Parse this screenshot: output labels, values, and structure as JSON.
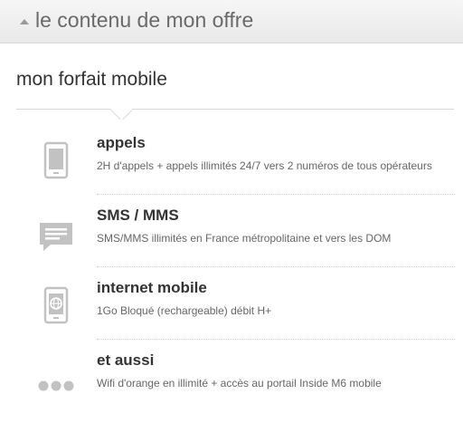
{
  "header": {
    "title": "le contenu de mon offre",
    "toggle_icon": "triangle-up-icon"
  },
  "section": {
    "title": "mon forfait mobile"
  },
  "items": [
    {
      "icon": "phone-icon",
      "label": "appels",
      "desc": "2H d'appels + appels illimités 24/7 vers 2 numéros de tous opérateurs"
    },
    {
      "icon": "message-icon",
      "label": "SMS / MMS",
      "desc": "SMS/MMS illimités en France métropolitaine et vers les DOM"
    },
    {
      "icon": "mobile-internet-icon",
      "label": "internet mobile",
      "desc": "1Go Bloqué (rechargeable) débit H+"
    },
    {
      "icon": "more-dots-icon",
      "label": "et aussi",
      "desc": "Wifi d'orange en illimité + accès au portail Inside M6 mobile"
    }
  ],
  "colors": {
    "icon_gray": "#c2c2c2",
    "text_dark": "#333333",
    "text_light": "#666666"
  }
}
